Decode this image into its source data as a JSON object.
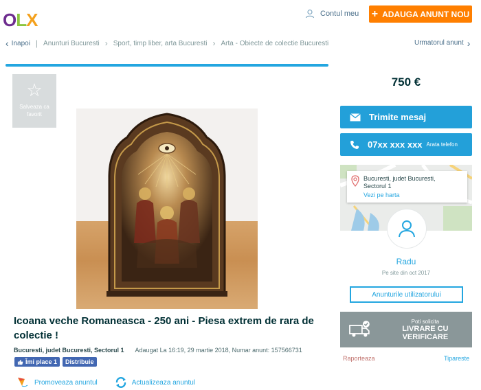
{
  "header": {
    "logo": {
      "o": "O",
      "l": "L",
      "x": "X"
    },
    "account_label": "Contul meu",
    "post_ad_label": "ADAUGA ANUNT NOU"
  },
  "breadcrumb": {
    "back_label": "Inapoi",
    "items": [
      "Anunturi Bucuresti",
      "Sport, timp liber, arta Bucuresti",
      "Arta - Obiecte de colectie Bucuresti"
    ],
    "next_label": "Urmatorul anunt"
  },
  "favorite": {
    "label": "Salveaza ca favorit"
  },
  "listing": {
    "title": "Icoana veche Romaneasca - 250 ani - Piesa extrem de rara de colectie !",
    "location": "Bucuresti, judet Bucuresti, Sectorul 1",
    "added": "Adaugat La 16:19, 29 martie 2018, Numar anunt: 157566731",
    "like_label": "Îmi place 1",
    "share_label": "Distribuie",
    "promote_label": "Promoveaza anuntul",
    "refresh_label": "Actualizeaza anuntul"
  },
  "sidebar": {
    "price": "750 €",
    "message_label": "Trimite mesaj",
    "phone_number": "07xx xxx xxx",
    "phone_reveal_label": "Arata telefon",
    "location_lines": [
      "Bucuresti, judet Bucuresti,",
      "Sectorul 1"
    ],
    "map_link_label": "Vezi pe harta",
    "user_name": "Radu",
    "member_since": "Pe site din oct 2017",
    "user_ads_label": "Anunturile utilizatorului",
    "delivery_line1": "Poti solicita",
    "delivery_line2": "LIVRARE CU VERIFICARE",
    "report_label": "Raporteaza",
    "print_label": "Tipareste"
  },
  "colors": {
    "accent_blue": "#23a0d9",
    "orange": "#ff7f00",
    "text_dark": "#002f34",
    "delivery_gray": "#8a9799"
  }
}
